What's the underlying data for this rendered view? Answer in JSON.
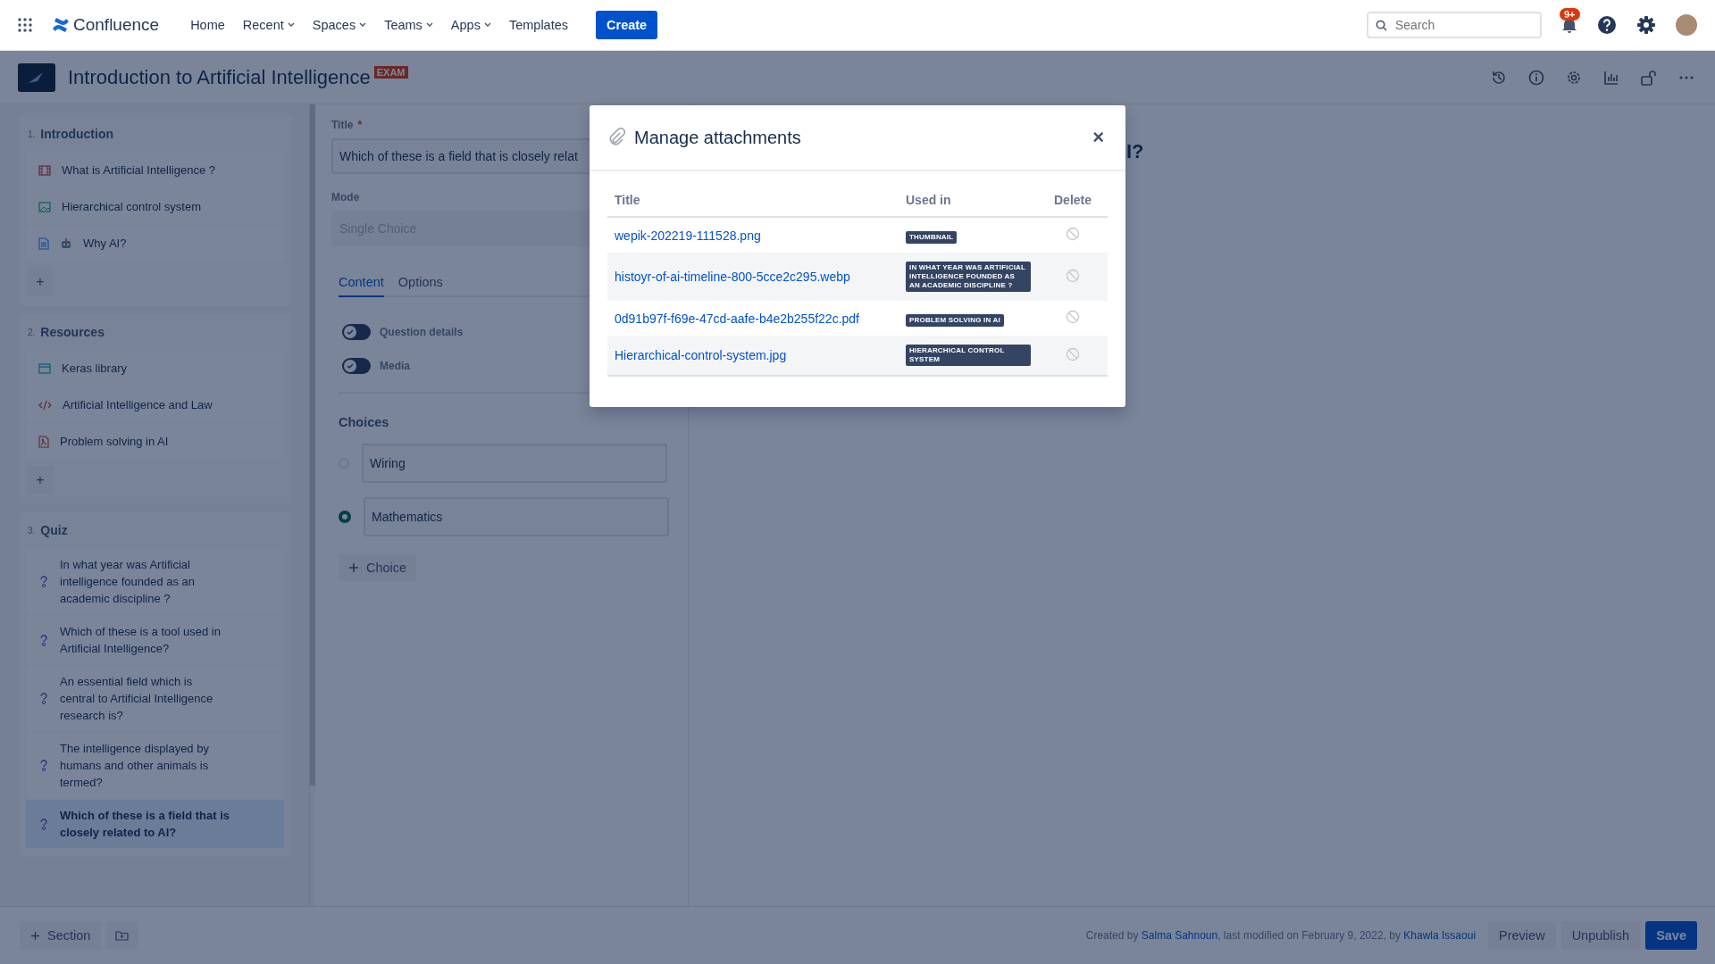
{
  "nav": {
    "app_name": "Confluence",
    "links": [
      {
        "label": "Home",
        "dropdown": false
      },
      {
        "label": "Recent",
        "dropdown": true
      },
      {
        "label": "Spaces",
        "dropdown": true
      },
      {
        "label": "Teams",
        "dropdown": true
      },
      {
        "label": "Apps",
        "dropdown": true
      },
      {
        "label": "Templates",
        "dropdown": false
      }
    ],
    "create_label": "Create",
    "search_placeholder": "Search",
    "notification_badge": "9+"
  },
  "page": {
    "title": "Introduction to Artificial Intelligence",
    "badge": "EXAM"
  },
  "sidebar": {
    "sections": [
      {
        "number": "1.",
        "title": "Introduction",
        "add_label": "+",
        "items": [
          {
            "kind": "video",
            "label": "What is Artificial Intelligence ?",
            "selected": false
          },
          {
            "kind": "image",
            "label": "Hierarchical control system",
            "selected": false
          },
          {
            "kind": "page",
            "label": "Why AI?",
            "robot": true,
            "selected": false
          }
        ]
      },
      {
        "number": "2.",
        "title": "Resources",
        "add_label": "+",
        "items": [
          {
            "kind": "web",
            "label": "Keras library",
            "selected": false
          },
          {
            "kind": "code",
            "label": "Artificial Intelligence and Law",
            "selected": false
          },
          {
            "kind": "pdf",
            "label": "Problem solving in AI",
            "selected": false
          }
        ]
      },
      {
        "number": "3.",
        "title": "Quiz",
        "items": [
          {
            "kind": "question",
            "label": "In what year was Artificial intelligence founded as an academic discipline ?",
            "selected": false
          },
          {
            "kind": "question",
            "label": "Which of these is a tool used in Artificial Intelligence?",
            "selected": false
          },
          {
            "kind": "question",
            "label": "An essential field which is central to Artificial Intelligence research is?",
            "selected": false
          },
          {
            "kind": "question",
            "label": "The intelligence displayed by humans and other animals is termed?",
            "selected": false
          },
          {
            "kind": "question",
            "label": "Which of these is a field that is closely related to AI?",
            "selected": true
          }
        ]
      }
    ]
  },
  "editor": {
    "title_label": "Title",
    "required_mark": "*",
    "title_value": "Which of these is a field that is closely relat",
    "mode_label": "Mode",
    "mode_placeholder": "Single Choice",
    "tabs": [
      {
        "label": "Content",
        "selected": true
      },
      {
        "label": "Options",
        "selected": false
      }
    ],
    "toggles": [
      {
        "label": "Question details",
        "on": false
      },
      {
        "label": "Media",
        "on": false
      }
    ],
    "choices_heading": "Choices",
    "choices": [
      {
        "value": "Wiring",
        "selected": false
      },
      {
        "value": "Mathematics",
        "selected": true
      }
    ],
    "add_choice_label": "Choice"
  },
  "preview": {
    "heading_fragment": "I?"
  },
  "modal": {
    "title": "Manage attachments",
    "close": "×",
    "columns": [
      "Title",
      "Used in",
      "Delete"
    ],
    "rows": [
      {
        "file": "wepik-202219-111528.png",
        "used_in": "THUMBNAIL"
      },
      {
        "file": "histoyr-of-ai-timeline-800-5cce2c295.webp",
        "used_in": "IN WHAT YEAR WAS ARTIFICIAL INTELLIGENCE FOUNDED AS AN ACADEMIC DISCIPLINE ?"
      },
      {
        "file": "0d91b97f-f69e-47cd-aafe-b4e2b255f22c.pdf",
        "used_in": "PROBLEM SOLVING IN AI"
      },
      {
        "file": "Hierarchical-control-system.jpg",
        "used_in": "HIERARCHICAL CONTROL SYSTEM"
      }
    ]
  },
  "footer": {
    "add_section_label": "Section",
    "created_prefix": "Created by",
    "author": "Salma Sahnoun",
    "modified_text": ", last modified on February 9, 2022, by",
    "editor": "Khawla Issaoui",
    "buttons": [
      {
        "label": "Preview",
        "kind": "secondary"
      },
      {
        "label": "Unpublish",
        "kind": "secondary"
      },
      {
        "label": "Save",
        "kind": "primary"
      }
    ]
  }
}
